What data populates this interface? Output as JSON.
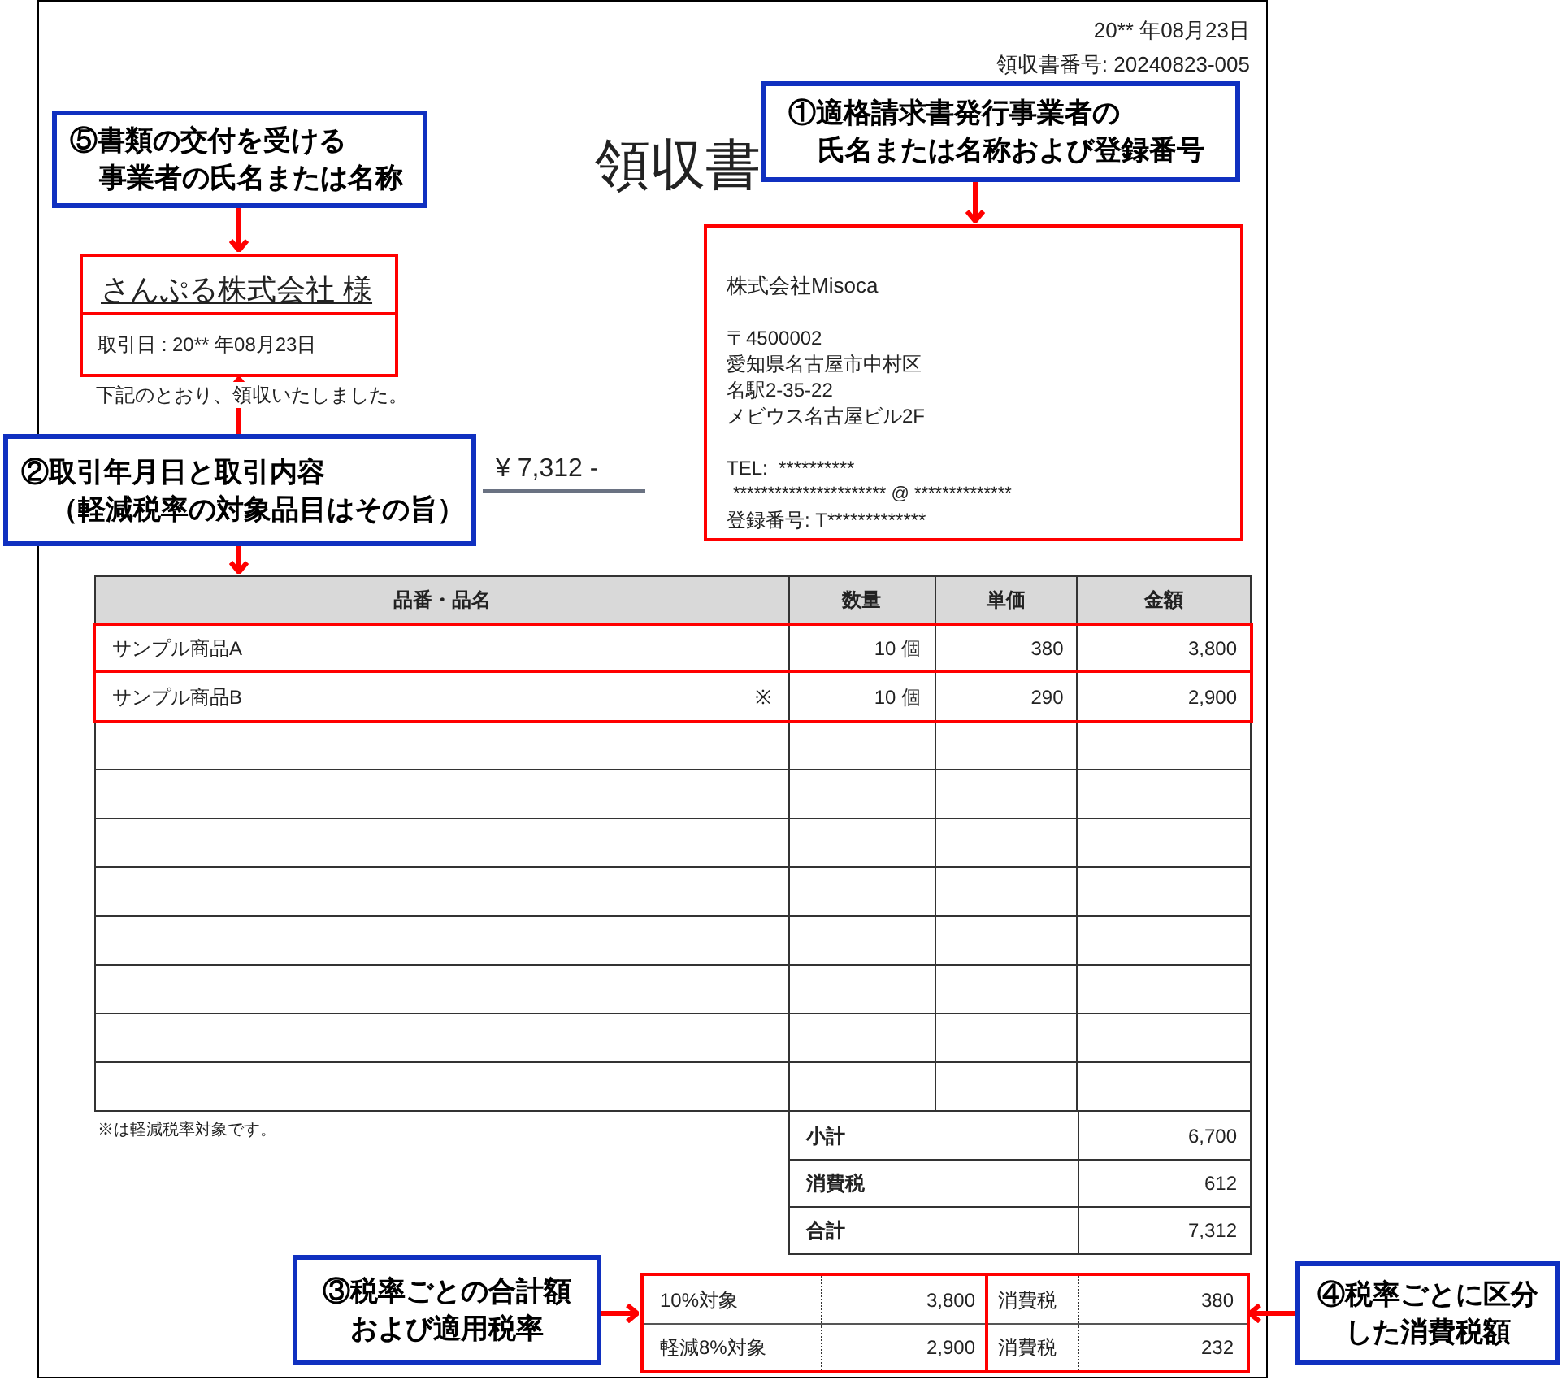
{
  "receipt": {
    "date": "20** 年08月23日",
    "receipt_number": "領収書番号: 20240823-005",
    "title": "領収書",
    "customer": {
      "name": "さんぷる株式会社 様",
      "transaction_date": "取引日 : 20** 年08月23日"
    },
    "message": "下記のとおり、領収いたしました。",
    "amount": "¥ 7,312 -",
    "issuer": {
      "company": "株式会社Misoca",
      "postal": "〒4500002",
      "address": [
        "愛知県名古屋市中村区",
        "名駅2-35-22",
        "メビウス名古屋ビル2F"
      ],
      "tel": "TEL:  **********",
      "email": "********************** @ **************",
      "registration": "登録番号: T*************"
    },
    "table": {
      "columns": [
        "品番・品名",
        "数量",
        "単価",
        "金額"
      ],
      "rows": [
        {
          "name": "サンプル商品A",
          "quantity": "10 個",
          "unit_price": "380",
          "amount": "3,800"
        },
        {
          "name": "サンプル商品B",
          "reduced_mark": "※",
          "quantity": "10 個",
          "unit_price": "290",
          "amount": "2,900"
        }
      ]
    },
    "note": "※は軽減税率対象です。",
    "totals": [
      {
        "label": "小計",
        "value": "6,700"
      },
      {
        "label": "消費税",
        "value": "612"
      },
      {
        "label": "合計",
        "value": "7,312"
      }
    ],
    "tax_breakdown": [
      {
        "label": "10%対象",
        "amount": "3,800",
        "tax_label": "消費税",
        "tax": "380"
      },
      {
        "label": "軽減8%対象",
        "amount": "2,900",
        "tax_label": "消費税",
        "tax": "232"
      }
    ]
  },
  "callouts": [
    {
      "lines": [
        "⑤書類の交付を受ける",
        "事業者の氏名または名称"
      ]
    },
    {
      "lines": [
        "①適格請求書発行事業者の",
        "氏名または名称および登録番号"
      ]
    },
    {
      "lines": [
        "②取引年月日と取引内容",
        "（軽減税率の対象品目はその旨）"
      ]
    },
    {
      "lines": [
        "③税率ごとの合計額",
        "および適用税率"
      ]
    },
    {
      "lines": [
        "④税率ごとに区分",
        "した消費税額"
      ]
    }
  ]
}
